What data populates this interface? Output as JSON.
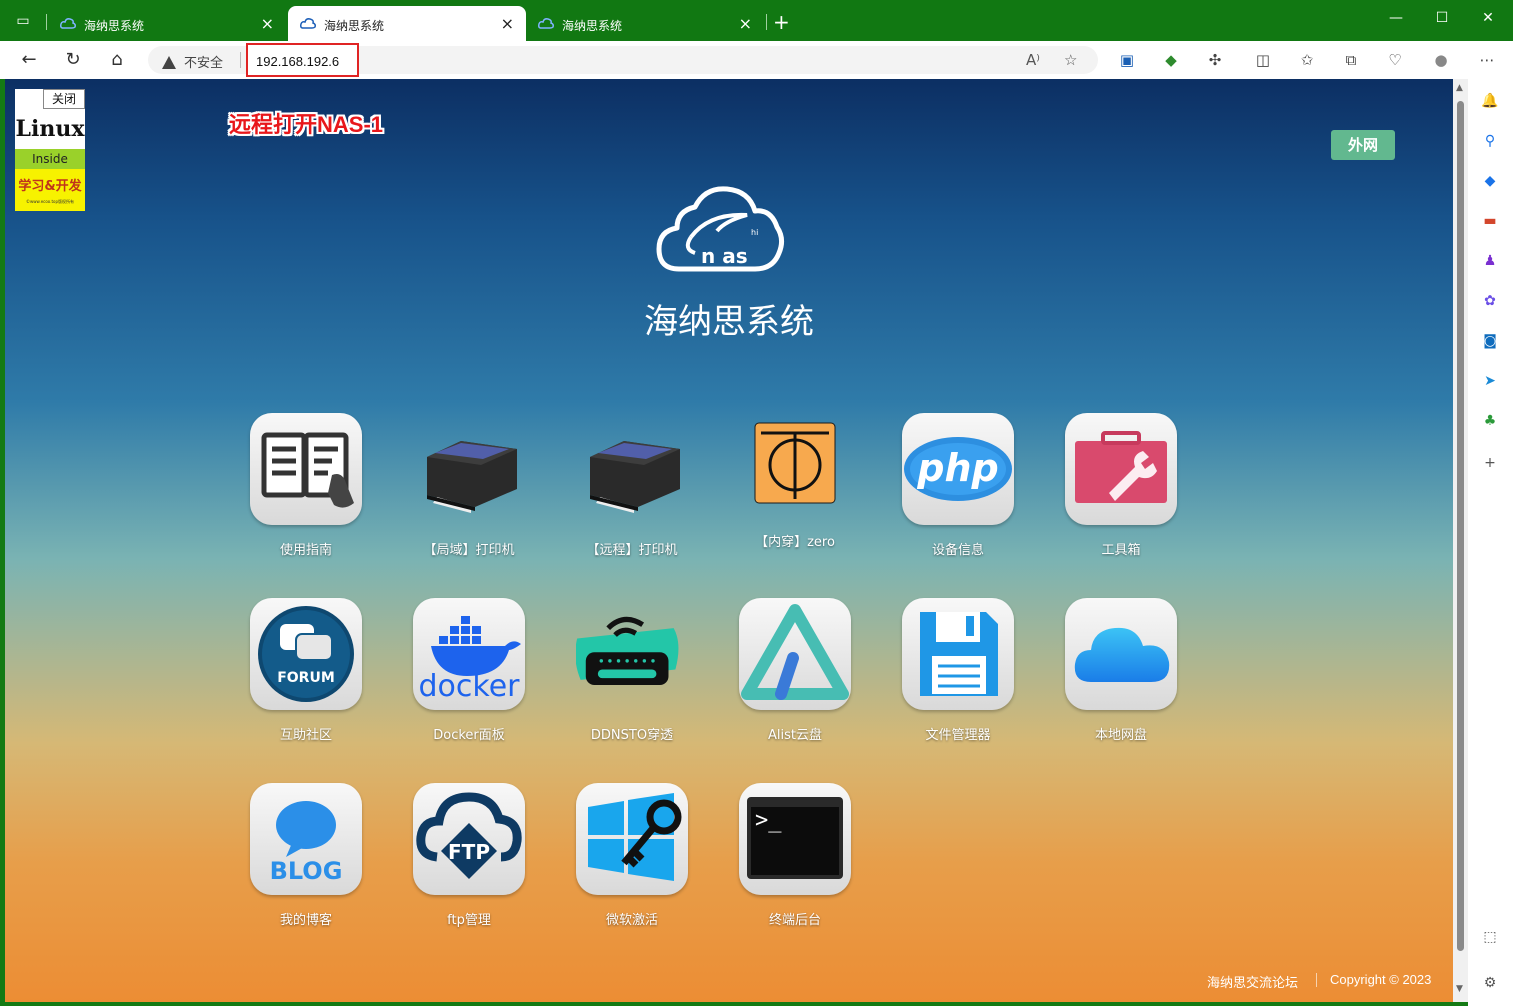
{
  "browser": {
    "tabs": [
      {
        "title": "海纳思系统",
        "active": false
      },
      {
        "title": "海纳思系统",
        "active": true
      },
      {
        "title": "海纳思系统",
        "active": false
      }
    ],
    "close_glyph": "×",
    "new_tab_glyph": "+",
    "security_label": "不安全",
    "url": "192.168.192.6",
    "window_controls": {
      "minimize": "—",
      "maximize": "☐",
      "close": "✕"
    },
    "theme_color": "#117812"
  },
  "page": {
    "ad": {
      "close_label": "关闭",
      "brand": "Linux",
      "tag": "Inside",
      "slogan": "学习&开发",
      "fine_print": "©www.ecoo.top版权所有"
    },
    "annotation": "远程打开NAS-1",
    "external_button": "外网",
    "logo_text": "n as",
    "logo_hi": "hi",
    "title": "海纳思系统",
    "apps": [
      {
        "label": "使用指南",
        "icon": "book-icon"
      },
      {
        "label": "【局域】打印机",
        "icon": "printer-icon"
      },
      {
        "label": "【远程】打印机",
        "icon": "printer-icon"
      },
      {
        "label": "【内穿】zero",
        "icon": "zerotier-icon"
      },
      {
        "label": "设备信息",
        "icon": "php-icon"
      },
      {
        "label": "工具箱",
        "icon": "toolbox-icon"
      },
      {
        "label": "互助社区",
        "icon": "forum-icon",
        "badge": "FORUM"
      },
      {
        "label": "Docker面板",
        "icon": "docker-icon",
        "badge": "docker"
      },
      {
        "label": "DDNSTO穿透",
        "icon": "router-icon"
      },
      {
        "label": "Alist云盘",
        "icon": "alist-icon"
      },
      {
        "label": "文件管理器",
        "icon": "floppy-icon"
      },
      {
        "label": "本地网盘",
        "icon": "cloud-icon"
      },
      {
        "label": "我的博客",
        "icon": "blog-icon",
        "badge": "BLOG"
      },
      {
        "label": "ftp管理",
        "icon": "ftp-icon",
        "badge": "FTP"
      },
      {
        "label": "微软激活",
        "icon": "windows-key-icon"
      },
      {
        "label": "终端后台",
        "icon": "terminal-icon",
        "badge": ">_"
      }
    ],
    "footer": {
      "forum": "海纳思交流论坛",
      "copyright": "Copyright © 2023"
    }
  }
}
